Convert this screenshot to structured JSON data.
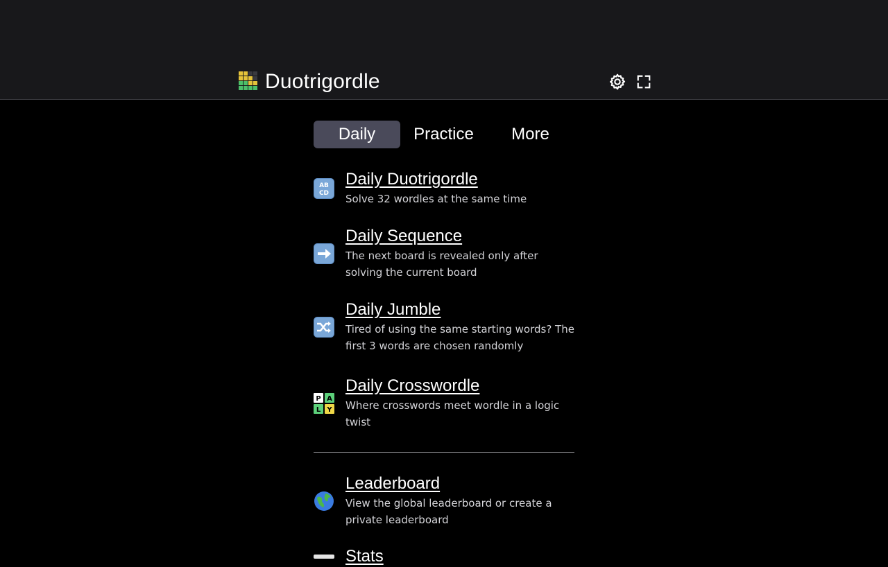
{
  "app": {
    "title": "Duotrigordle",
    "logo_colors": [
      "#e5c33a",
      "#e5c33a",
      "#3a3a3f",
      "#3a3a3f",
      "#e5c33a",
      "#e5c33a",
      "#e5c33a",
      "#3a3a3f",
      "#4cc06a",
      "#4cc06a",
      "#e5c33a",
      "#e5c33a",
      "#4cc06a",
      "#4cc06a",
      "#4cc06a",
      "#4cc06a"
    ]
  },
  "header": {
    "settings_icon": "gear-icon",
    "fullscreen_icon": "fullscreen-icon"
  },
  "tabs": [
    {
      "label": "Daily",
      "active": true
    },
    {
      "label": "Practice",
      "active": false
    },
    {
      "label": "More",
      "active": false
    }
  ],
  "items": [
    {
      "icon": "abcd-icon",
      "title": "Daily Duotrigordle",
      "desc": "Solve 32 wordles at the same time"
    },
    {
      "icon": "right-arrow-icon",
      "title": "Daily Sequence",
      "desc": "The next board is revealed only after solving the current board"
    },
    {
      "icon": "shuffle-icon",
      "title": "Daily Jumble",
      "desc": "Tired of using the same starting words? The first 3 words are chosen randomly"
    },
    {
      "icon": "play-tiles-icon",
      "title": "Daily Crosswordle",
      "desc": "Where crosswords meet wordle in a logic twist"
    },
    {
      "icon": "globe-icon",
      "title": "Leaderboard",
      "desc": "View the global leaderboard or create a private leaderboard"
    },
    {
      "icon": "stats-icon",
      "title": "Stats",
      "desc": ""
    }
  ],
  "colors": {
    "topbar": "#18181b",
    "active_tab": "#4a4a5a",
    "emoji_blue": "#7aa7d8"
  }
}
